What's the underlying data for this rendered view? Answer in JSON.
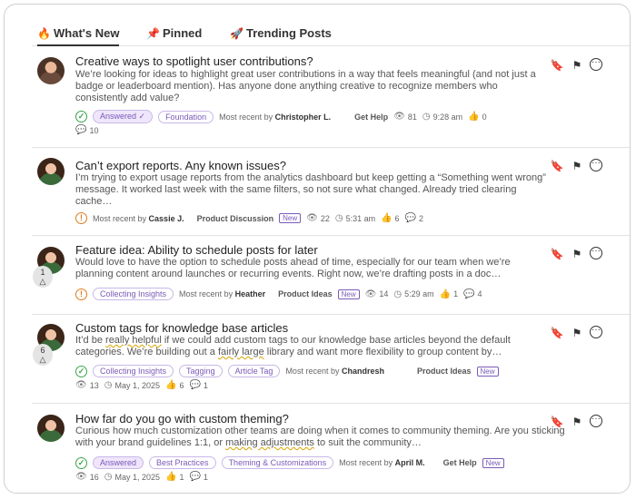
{
  "tabs": [
    {
      "label": "What's New",
      "icon": "fire-icon",
      "glyph": "🔥"
    },
    {
      "label": "Pinned",
      "icon": "pin-icon",
      "glyph": "📌"
    },
    {
      "label": "Trending Posts",
      "icon": "rocket-icon",
      "glyph": "🚀"
    }
  ],
  "posts": [
    {
      "title": "Creative ways to spotlight user contributions?",
      "excerpt": "We’re looking for ideas to highlight great user contributions in a way that feels meaningful (and not just a badge or leaderboard mention). Has anyone done anything creative to recognize members who consistently add value?",
      "status": "answered",
      "tags": [
        "Answered ✓",
        "Foundation"
      ],
      "recent_prefix": "Most recent by",
      "recent_user": "Christopher L.",
      "category": "Get Help",
      "views": "81",
      "time": "9:28 am",
      "likes": "0",
      "comments": "10"
    },
    {
      "title": "Can’t export reports. Any known issues?",
      "excerpt": "I’m trying to export usage reports from the analytics dashboard but keep getting a “Something went wrong” message. It worked last week with the same filters, so not sure what changed. Already tried clearing cache…",
      "status": "open",
      "recent_prefix": "Most recent by",
      "recent_user": "Cassie J.",
      "category": "Product Discussion",
      "badge": "New",
      "views": "22",
      "time": "5:31 am",
      "likes": "6",
      "comments": "2"
    },
    {
      "title": "Feature idea: Ability to schedule posts for later",
      "excerpt": "Would love to have the option to schedule posts ahead of time, especially for our team when we’re planning content around launches or recurring events. Right now, we’re drafting posts in a doc…",
      "status": "open",
      "votes": "1",
      "tags": [
        "Collecting Insights"
      ],
      "recent_prefix": "Most recent by",
      "recent_user": "Heather",
      "category": "Product Ideas",
      "badge": "New",
      "views": "14",
      "time": "5:29 am",
      "likes": "1",
      "comments": "4"
    },
    {
      "title": "Custom tags for knowledge base articles",
      "excerpt_a": "It’d be ",
      "excerpt_u1": "really helpful",
      "excerpt_b": " if we could add custom tags to our knowledge base articles beyond the default categories. We’re building out a ",
      "excerpt_u2": "fairly large",
      "excerpt_c": " library and want more flexibility to group content by…",
      "status": "answered",
      "votes": "6",
      "tags": [
        "Collecting Insights",
        "Tagging",
        "Article Tag"
      ],
      "recent_prefix": "Most recent by",
      "recent_user": "Chandresh",
      "category": "Product Ideas",
      "badge": "New",
      "views": "13",
      "time": "May 1, 2025",
      "likes": "6",
      "comments": "1"
    },
    {
      "title": "How far do you go with custom theming?",
      "excerpt_a": "Curious how much customization other teams are doing when it comes to community theming. Are you sticking with your brand guidelines 1:1, or ",
      "excerpt_u1": "making adjustments",
      "excerpt_b": " to suit the community…",
      "status": "answered",
      "tags": [
        "Answered",
        "Best Practices",
        "Theming & Customizations"
      ],
      "recent_prefix": "Most recent by",
      "recent_user": "April M.",
      "category": "Get Help",
      "badge": "New",
      "views": "16",
      "time": "May 1, 2025",
      "likes": "1",
      "comments": "1"
    }
  ],
  "icons": {
    "bookmark": "bookmark-icon",
    "flag": "flag-icon",
    "more": "more-icon",
    "views": "eye-icon",
    "time": "clock-icon",
    "likes": "thumbs-up-icon",
    "comments": "comment-icon"
  },
  "glyphs": {
    "bookmark": "🔖",
    "flag": "⚑",
    "more": "···",
    "eye": "👁",
    "clock": "◷",
    "like": "👍",
    "comment": "💬",
    "check": "✓",
    "warn": "!",
    "up": "△"
  },
  "colors": {
    "accent": "#7a5ab8",
    "success": "#3aa64a",
    "warning": "#e07a1f"
  }
}
